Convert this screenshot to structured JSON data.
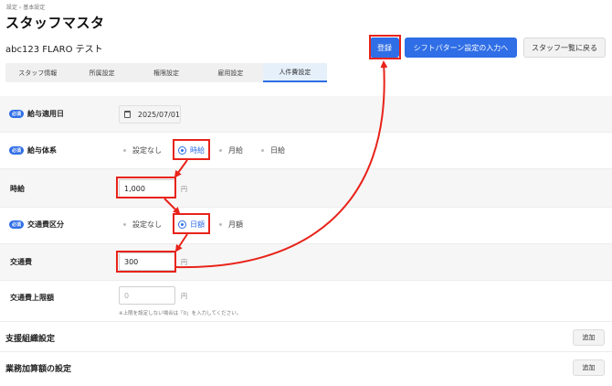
{
  "breadcrumb": "設定 › 基本設定",
  "page_title": "スタッフマスタ",
  "staff_name": "abc123 FLARO テスト",
  "buttons": {
    "register": "登録",
    "shift_pattern": "シフトパターン設定の入力へ",
    "back_to_list": "スタッフ一覧に戻る",
    "add": "追加"
  },
  "tabs": [
    {
      "label": "スタッフ情報"
    },
    {
      "label": "所属設定"
    },
    {
      "label": "権限設定"
    },
    {
      "label": "雇用設定"
    },
    {
      "label": "人件費設定"
    }
  ],
  "active_tab": "人件費設定",
  "required_badge": "必須",
  "form": {
    "salary_start_date": {
      "label": "給与適用日",
      "value": "2025/07/01"
    },
    "salary_type": {
      "label": "給与体系",
      "options": [
        "設定なし",
        "時給",
        "月給",
        "日給"
      ],
      "selected": "時給"
    },
    "hourly_wage": {
      "label": "時給",
      "value": "1,000",
      "unit": "円"
    },
    "transport_type": {
      "label": "交通費区分",
      "options": [
        "設定なし",
        "日額",
        "月額"
      ],
      "selected": "日額"
    },
    "transport_fee": {
      "label": "交通費",
      "value": "300",
      "unit": "円"
    },
    "transport_limit": {
      "label": "交通費上限額",
      "placeholder": "0",
      "unit": "円",
      "note": "※上限を設定しない場合は「0」を入力してください。"
    }
  },
  "sections": {
    "support_org": "支援組織設定",
    "task_addition": "業務加算額の設定"
  },
  "colors": {
    "accent": "#2f6ee6",
    "annotation": "#e8231a"
  }
}
